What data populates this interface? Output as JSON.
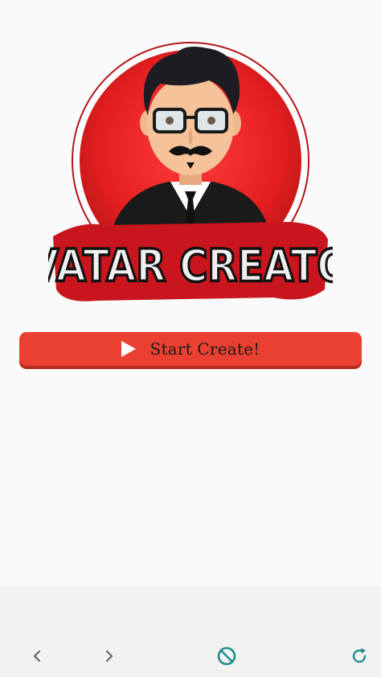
{
  "logo": {
    "text": "AVATAR CREATOR",
    "colors": {
      "circle": "#e21e1e",
      "outline": "#b3151a",
      "letters": "#f2f2f2"
    }
  },
  "start_button": {
    "label": "Start Create!",
    "icon": "play-icon",
    "color": "#ea4032"
  },
  "nav": {
    "back_icon": "chevron-left-icon",
    "forward_icon": "chevron-right-icon",
    "block_icon": "block-icon",
    "refresh_icon": "refresh-icon",
    "accent": "#1e8d8d"
  }
}
